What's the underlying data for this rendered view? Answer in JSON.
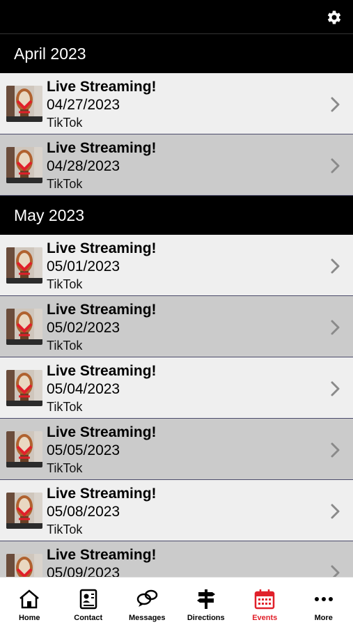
{
  "header": {
    "settings_icon": "gear-icon"
  },
  "colors": {
    "accent": "#e0202a",
    "row_light": "#efefef",
    "row_dark": "#cbcbcb",
    "header_bg": "#000000"
  },
  "sections": [
    {
      "label": "April 2023",
      "events": [
        {
          "title": "Live Streaming!",
          "date": "04/27/2023",
          "venue": "TikTok"
        },
        {
          "title": "Live Streaming!",
          "date": "04/28/2023",
          "venue": "TikTok"
        }
      ]
    },
    {
      "label": "May 2023",
      "events": [
        {
          "title": "Live Streaming!",
          "date": "05/01/2023",
          "venue": "TikTok"
        },
        {
          "title": "Live Streaming!",
          "date": "05/02/2023",
          "venue": "TikTok"
        },
        {
          "title": "Live Streaming!",
          "date": "05/04/2023",
          "venue": "TikTok"
        },
        {
          "title": "Live Streaming!",
          "date": "05/05/2023",
          "venue": "TikTok"
        },
        {
          "title": "Live Streaming!",
          "date": "05/08/2023",
          "venue": "TikTok"
        },
        {
          "title": "Live Streaming!",
          "date": "05/09/2023",
          "venue": ""
        }
      ]
    }
  ],
  "tabs": [
    {
      "label": "Home",
      "icon": "home-icon"
    },
    {
      "label": "Contact",
      "icon": "contact-card-icon"
    },
    {
      "label": "Messages",
      "icon": "chat-bubbles-icon"
    },
    {
      "label": "Directions",
      "icon": "signpost-icon"
    },
    {
      "label": "Events",
      "icon": "calendar-icon",
      "active": true
    },
    {
      "label": "More",
      "icon": "more-dots-icon"
    }
  ]
}
